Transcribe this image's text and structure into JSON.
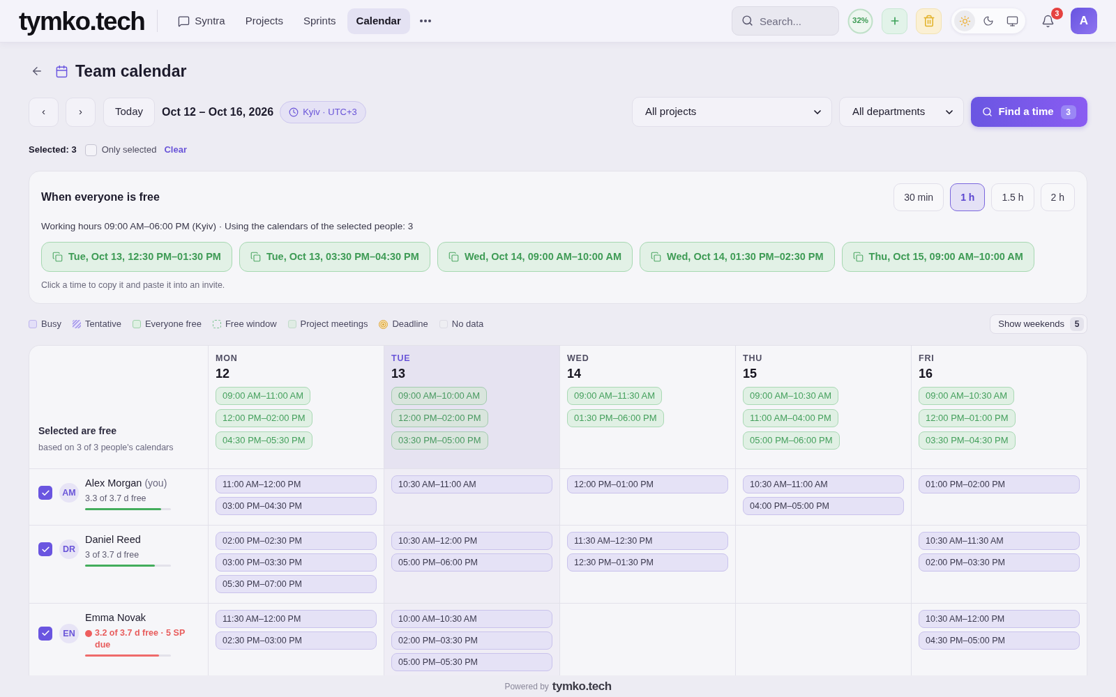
{
  "nav": {
    "logo": "tymko.tech",
    "items": [
      {
        "label": "Syntra",
        "kind": "icon_link",
        "selected": false
      },
      {
        "label": "Projects",
        "kind": "link",
        "selected": false
      },
      {
        "label": "Sprints",
        "kind": "link",
        "selected": false
      },
      {
        "label": "Calendar",
        "kind": "link",
        "selected": true
      }
    ],
    "search": {
      "placeholder": "Search..."
    },
    "progress": {
      "label": "32%"
    },
    "theme": [
      {
        "kind": "light",
        "selected": true
      },
      {
        "kind": "dark",
        "selected": false
      },
      {
        "kind": "system",
        "selected": false
      }
    ],
    "notifications": {
      "count": "3"
    },
    "avatar": {
      "initial": "A"
    }
  },
  "page": {
    "title": "Team calendar"
  },
  "toolbar": {
    "prev": "‹",
    "next": "›",
    "today": "Today",
    "range": "Oct 12 – Oct 16, 2026",
    "timezone": "Kyiv · UTC+3",
    "project_filter": "All projects",
    "department_filter": "All departments",
    "find_button": {
      "label": "Find a time",
      "count": "3"
    }
  },
  "selection": {
    "label": "Selected: 3",
    "only_selected": {
      "label": "Only selected",
      "checked": false
    },
    "clear": "Clear"
  },
  "free_panel": {
    "title": "When everyone is free",
    "durations": [
      {
        "label": "30 min",
        "selected": false
      },
      {
        "label": "1 h",
        "selected": true
      },
      {
        "label": "1.5 h",
        "selected": false
      },
      {
        "label": "2 h",
        "selected": false
      }
    ],
    "summary": "Working hours 09:00 AM–06:00 PM (Kyiv) · Using the calendars of the selected people: 3",
    "slots": [
      "Tue, Oct 13, 12:30 PM–01:30 PM",
      "Tue, Oct 13, 03:30 PM–04:30 PM",
      "Wed, Oct 14, 09:00 AM–10:00 AM",
      "Wed, Oct 14, 01:30 PM–02:30 PM",
      "Thu, Oct 15, 09:00 AM–10:00 AM"
    ],
    "hint": "Click a time to copy it and paste it into an invite."
  },
  "legend": [
    {
      "label": "Busy",
      "kind": "busy"
    },
    {
      "label": "Tentative",
      "kind": "tentative"
    },
    {
      "label": "Everyone free",
      "kind": "everyone_free"
    },
    {
      "label": "Free window",
      "kind": "free_window"
    },
    {
      "label": "Project meetings",
      "kind": "meetings"
    },
    {
      "label": "Deadline",
      "kind": "deadline"
    },
    {
      "label": "No data",
      "kind": "no_data"
    }
  ],
  "show_weekends": {
    "label": "Show weekends",
    "count": "5"
  },
  "grid": {
    "summary": {
      "title": "Selected are free",
      "subtitle": "based on 3 of 3 people's calendars"
    },
    "days": [
      {
        "weekday": "MON",
        "date": "12",
        "today": false,
        "free": [
          "09:00 AM–11:00 AM",
          "12:00 PM–02:00 PM",
          "04:30 PM–05:30 PM"
        ]
      },
      {
        "weekday": "TUE",
        "date": "13",
        "today": true,
        "free": [
          "09:00 AM–10:00 AM",
          "12:00 PM–02:00 PM",
          "03:30 PM–05:00 PM"
        ]
      },
      {
        "weekday": "WED",
        "date": "14",
        "today": false,
        "free": [
          "09:00 AM–11:30 AM",
          "01:30 PM–06:00 PM"
        ]
      },
      {
        "weekday": "THU",
        "date": "15",
        "today": false,
        "free": [
          "09:00 AM–10:30 AM",
          "11:00 AM–04:00 PM",
          "05:00 PM–06:00 PM"
        ]
      },
      {
        "weekday": "FRI",
        "date": "16",
        "today": false,
        "free": [
          "09:00 AM–10:30 AM",
          "12:00 PM–01:00 PM",
          "03:30 PM–04:30 PM"
        ]
      }
    ],
    "people": [
      {
        "initials": "AM",
        "name": "Alex Morgan",
        "note": "(you)",
        "checked": true,
        "availability": "3.3 of 3.7 d free",
        "warning": false,
        "level": 0.89,
        "cells": [
          {
            "busy": [
              "11:00 AM–12:00 PM",
              "03:00 PM–04:30 PM"
            ]
          },
          {
            "busy": [
              "10:30 AM–11:00 AM"
            ]
          },
          {
            "busy": [
              "12:00 PM–01:00 PM"
            ]
          },
          {
            "busy": [
              "10:30 AM–11:00 AM",
              "04:00 PM–05:00 PM"
            ]
          },
          {
            "busy": [
              "01:00 PM–02:00 PM"
            ]
          }
        ]
      },
      {
        "initials": "DR",
        "name": "Daniel Reed",
        "checked": true,
        "availability": "3 of 3.7 d free",
        "warning": false,
        "level": 0.81,
        "cells": [
          {
            "busy": [
              "02:00 PM–02:30 PM",
              "03:00 PM–03:30 PM",
              "05:30 PM–07:00 PM"
            ]
          },
          {
            "busy": [
              "10:30 AM–12:00 PM",
              "05:00 PM–06:00 PM"
            ]
          },
          {
            "busy": [
              "11:30 AM–12:30 PM",
              "12:30 PM–01:30 PM"
            ]
          },
          {},
          {
            "busy": [
              "10:30 AM–11:30 AM",
              "02:00 PM–03:30 PM"
            ]
          }
        ]
      },
      {
        "initials": "EN",
        "name": "Emma Novak",
        "checked": true,
        "availability": "3.2 of 3.7 d free · 5 SP due",
        "warning": true,
        "level": 0.86,
        "cells": [
          {
            "busy": [
              "11:30 AM–12:00 PM",
              "02:30 PM–03:00 PM"
            ]
          },
          {
            "busy": [
              "10:00 AM–10:30 AM",
              "02:00 PM–03:30 PM",
              "05:00 PM–05:30 PM"
            ]
          },
          {},
          {},
          {
            "busy": [
              "10:30 AM–12:00 PM",
              "04:30 PM–05:00 PM"
            ]
          }
        ]
      }
    ]
  },
  "footer": {
    "label": "Powered by",
    "logo": "tymko.tech"
  }
}
